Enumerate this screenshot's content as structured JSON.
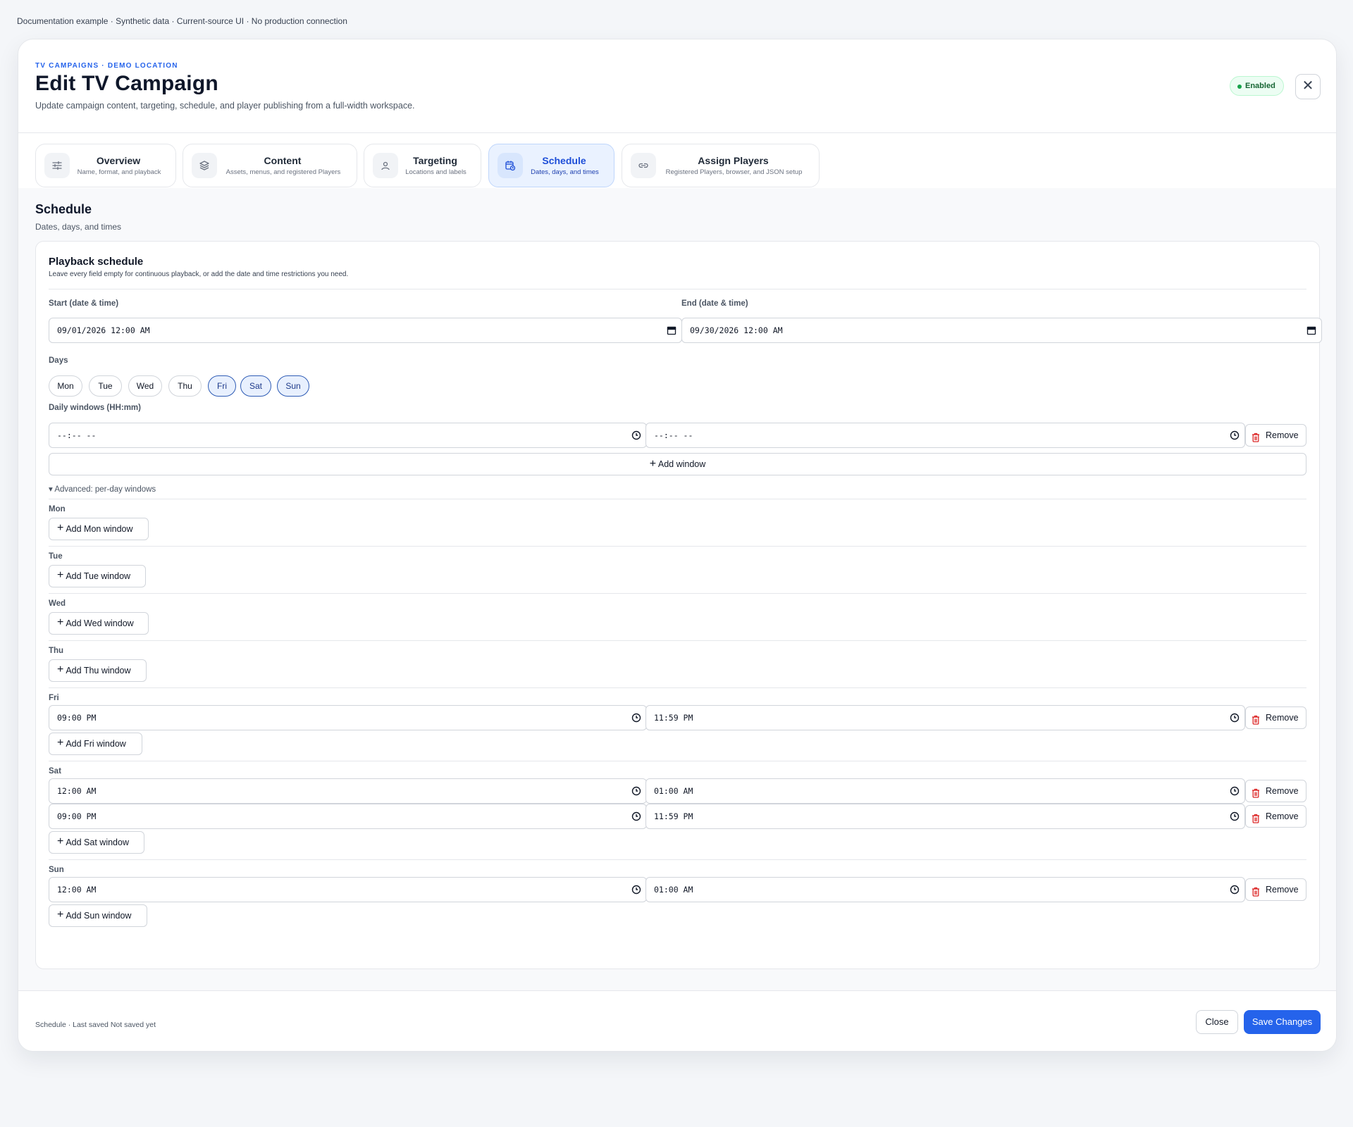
{
  "top_note": "Documentation example · Synthetic data · Current-source UI · No production connection",
  "header": {
    "eyebrow": "TV CAMPAIGNS · DEMO LOCATION",
    "title": "Edit TV Campaign",
    "subtitle": "Update campaign content, targeting, schedule, and player publishing from a full-width workspace.",
    "status_badge": "Enabled",
    "close_icon": "close-icon",
    "badge_color": "#16a34a"
  },
  "tabs": [
    {
      "label": "Overview",
      "sub": "Name, format, and playback",
      "icon": "sliders-icon",
      "active": false
    },
    {
      "label": "Content",
      "sub": "Assets, menus, and registered Players",
      "icon": "layers-icon",
      "active": false
    },
    {
      "label": "Targeting",
      "sub": "Locations and labels",
      "icon": "location-pin-icon",
      "active": false
    },
    {
      "label": "Schedule",
      "sub": "Dates, days, and times",
      "icon": "calendar-clock-icon",
      "active": true
    },
    {
      "label": "Assign Players",
      "sub": "Registered Players, browser, and JSON setup",
      "icon": "link-icon",
      "active": false
    }
  ],
  "section": {
    "title": "Schedule",
    "subtitle": "Dates, days, and times"
  },
  "card": {
    "title": "Playback schedule",
    "subtitle": "Leave every field empty for continuous playback, or add the date and time restrictions you need.",
    "start_label": "Start (date & time)",
    "start_value": "09/01/2026 12:00 AM",
    "end_label": "End (date & time)",
    "end_value": "09/30/2026 12:00 AM",
    "days_label": "Days",
    "days": [
      {
        "label": "Mon",
        "selected": false
      },
      {
        "label": "Tue",
        "selected": false
      },
      {
        "label": "Wed",
        "selected": false
      },
      {
        "label": "Thu",
        "selected": false
      },
      {
        "label": "Fri",
        "selected": true
      },
      {
        "label": "Sat",
        "selected": true
      },
      {
        "label": "Sun",
        "selected": true
      }
    ],
    "daily_windows_label": "Daily windows (HH:mm)",
    "daily_window": {
      "start": "--:-- --",
      "end": "--:-- --"
    },
    "remove_label": "Remove",
    "add_window_label": "Add window",
    "advanced_label": "▾ Advanced: per-day windows",
    "per_day": [
      {
        "day": "Mon",
        "add_label": "Add Mon window",
        "windows": []
      },
      {
        "day": "Tue",
        "add_label": "Add Tue window",
        "windows": []
      },
      {
        "day": "Wed",
        "add_label": "Add Wed window",
        "windows": []
      },
      {
        "day": "Thu",
        "add_label": "Add Thu window",
        "windows": []
      },
      {
        "day": "Fri",
        "add_label": "Add Fri window",
        "windows": [
          {
            "start": "09:00 PM",
            "end": "11:59 PM"
          }
        ]
      },
      {
        "day": "Sat",
        "add_label": "Add Sat window",
        "windows": [
          {
            "start": "12:00 AM",
            "end": "01:00 AM"
          },
          {
            "start": "09:00 PM",
            "end": "11:59 PM"
          }
        ]
      },
      {
        "day": "Sun",
        "add_label": "Add Sun window",
        "windows": [
          {
            "start": "12:00 AM",
            "end": "01:00 AM"
          }
        ]
      }
    ]
  },
  "footer": {
    "status": "Schedule · Last saved Not saved yet",
    "close_label": "Close",
    "save_label": "Save Changes",
    "accent_color": "#2563eb"
  }
}
